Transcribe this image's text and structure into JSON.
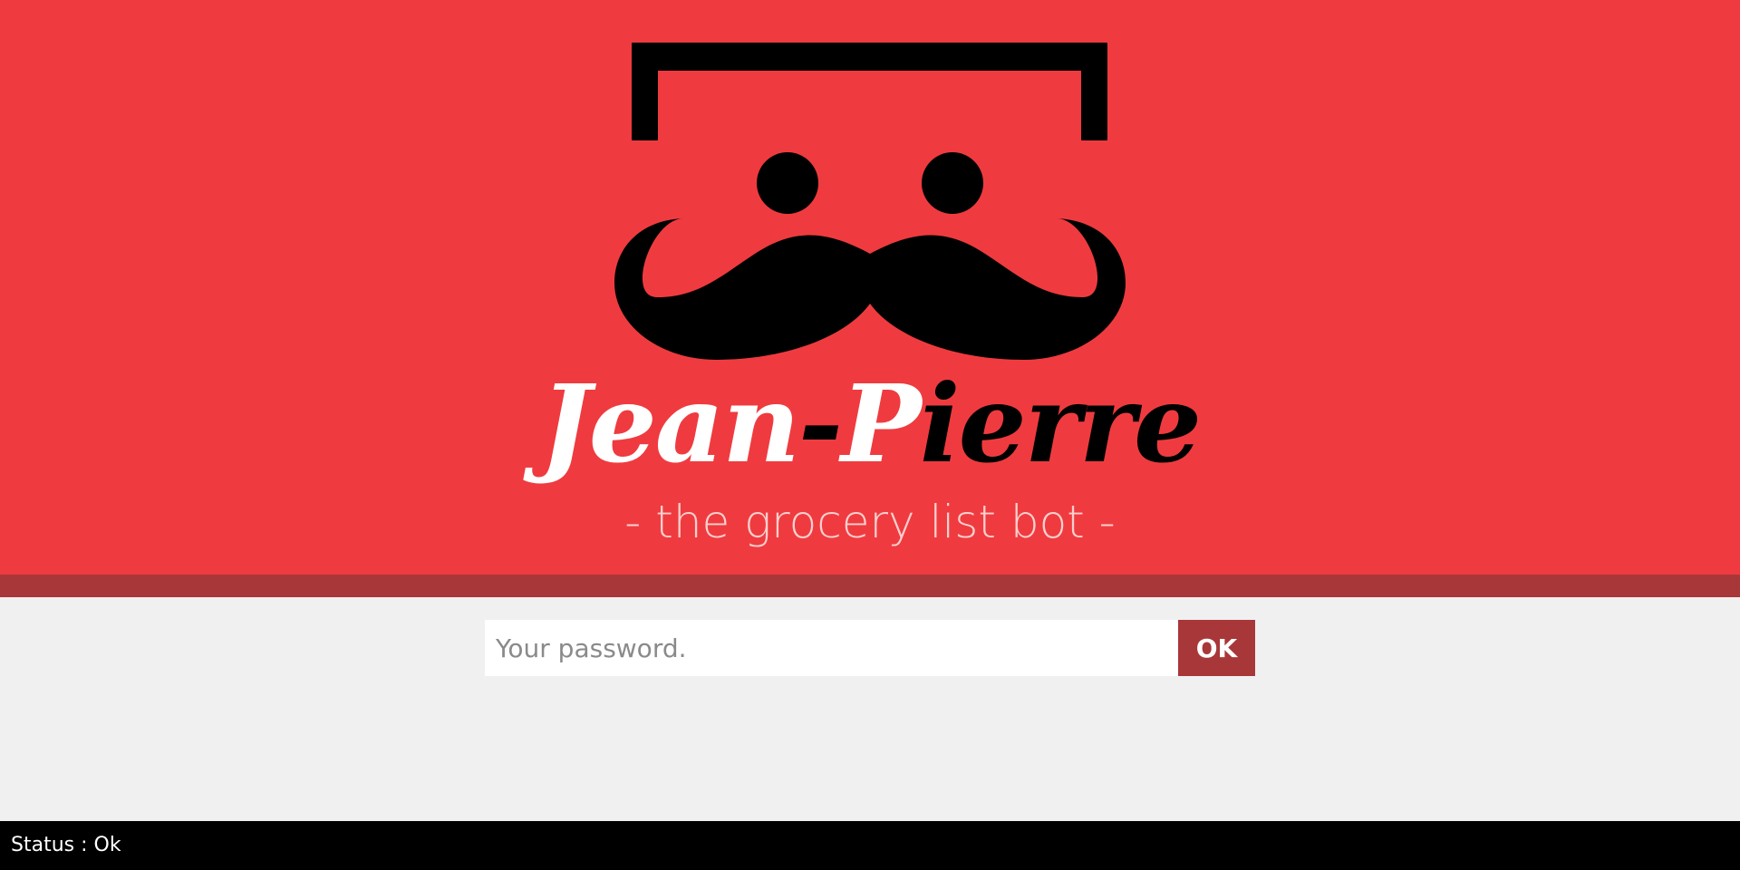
{
  "app": {
    "title_first": "Jean",
    "title_dash": "-",
    "title_p": "P",
    "title_rest": "ierre",
    "subtitle": "- the grocery list bot -"
  },
  "logo": {
    "icon": "mustache-face-icon",
    "colors": {
      "header_background": "#ef3b3f",
      "band": "#a8373a",
      "drawing": "#000000"
    }
  },
  "login": {
    "password_placeholder": "Your password.",
    "password_value": "",
    "ok_label": "OK"
  },
  "status": {
    "text": "Status : Ok"
  }
}
